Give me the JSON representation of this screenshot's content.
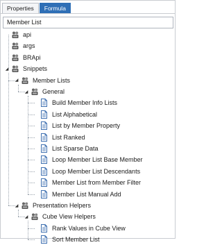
{
  "tabs": [
    {
      "label": "Properties",
      "active": false
    },
    {
      "label": "Formula",
      "active": true
    }
  ],
  "header": {
    "title": "Member List"
  },
  "tree": [
    {
      "label": "api",
      "type": "namespace",
      "level": 0,
      "expanded": false
    },
    {
      "label": "args",
      "type": "namespace",
      "level": 0,
      "expanded": false
    },
    {
      "label": "BRApi",
      "type": "namespace",
      "level": 0,
      "expanded": false
    },
    {
      "label": "Snippets",
      "type": "namespace",
      "level": 0,
      "expanded": true
    },
    {
      "label": "Member Lists",
      "type": "namespace",
      "level": 1,
      "expanded": true
    },
    {
      "label": "General",
      "type": "namespace",
      "level": 2,
      "expanded": true
    },
    {
      "label": "Build Member Info Lists",
      "type": "document",
      "level": 3
    },
    {
      "label": "List Alphabetical",
      "type": "document",
      "level": 3
    },
    {
      "label": "List by Member Property",
      "type": "document",
      "level": 3
    },
    {
      "label": "List Ranked",
      "type": "document",
      "level": 3
    },
    {
      "label": "List Sparse Data",
      "type": "document",
      "level": 3
    },
    {
      "label": "Loop Member List Base Member",
      "type": "document",
      "level": 3
    },
    {
      "label": "Loop Member List Descendants",
      "type": "document",
      "level": 3
    },
    {
      "label": "Member List from Member Filter",
      "type": "document",
      "level": 3
    },
    {
      "label": "Member List Manual Add",
      "type": "document",
      "level": 3
    },
    {
      "label": "Presentation Helpers",
      "type": "namespace",
      "level": 1,
      "expanded": true
    },
    {
      "label": "Cube View Helpers",
      "type": "namespace",
      "level": 2,
      "expanded": true
    },
    {
      "label": "Rank Values in Cube View",
      "type": "document",
      "level": 3
    },
    {
      "label": "Sort Member List",
      "type": "document",
      "level": 3
    }
  ],
  "colors": {
    "accent": "#2f6fb6",
    "doc_icon": "#3d6fb0",
    "folder_icon": "#555555"
  }
}
